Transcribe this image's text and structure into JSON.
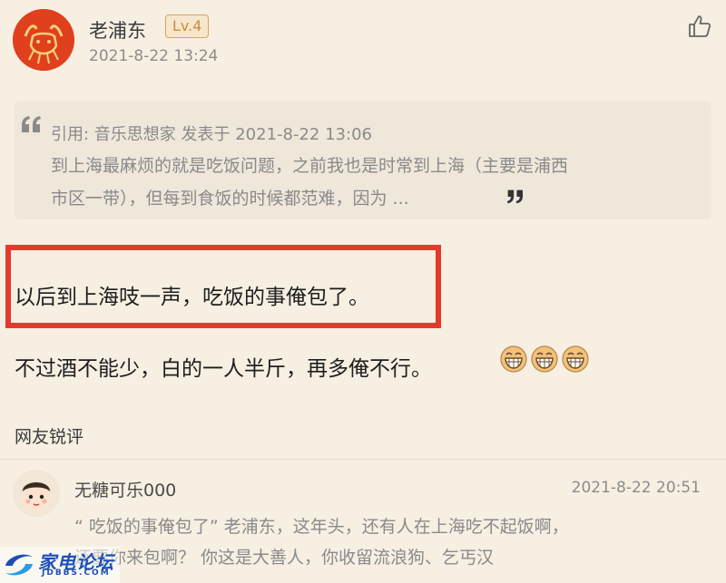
{
  "post": {
    "author": "老浦东",
    "level": "Lv.4",
    "time": "2021-8-22 13:24",
    "quote": {
      "meta": "引用: 音乐思想家 发表于 2021-8-22 13:06",
      "line1": "到上海最麻烦的就是吃饭问题，之前我也是时常到上海（主要是浦西",
      "line2": "市区一带），但每到食饭的时候都范难，因为 ..."
    },
    "body_line1": "以后到上海吱一声，吃饭的事俺包了。",
    "body_line2": "不过酒不能少，白的一人半斤，再多俺不行。"
  },
  "comments": {
    "section_title": "网友锐评",
    "items": [
      {
        "user": "无糖可乐000",
        "time": "2021-8-22 20:51",
        "line1": "“ 吃饭的事俺包了” 老浦东，这年头，还有人在上海吃不起饭啊，",
        "line2": "还要你来包啊？ 你这是大善人，你收留流浪狗、乞丐汉"
      }
    ]
  },
  "watermark": {
    "name": "家电论坛",
    "url": "JDBBS.COM"
  },
  "colors": {
    "background": "#f6efe2",
    "highlight_border": "#e33a2c",
    "level_badge": "#c98d3e",
    "watermark_blue": "#1d4fb5"
  },
  "icons": {
    "author_avatar": "bull-avatar-icon",
    "like": "thumbs-up-icon",
    "quote_open": "quote-open-icon",
    "quote_close": "quote-close-icon",
    "emoji": "grinning-face-icon",
    "commenter_avatar": "cartoon-boy-avatar-icon"
  }
}
